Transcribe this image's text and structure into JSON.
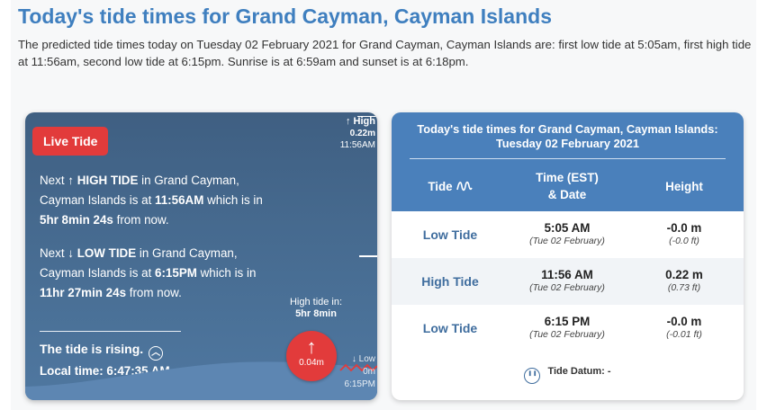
{
  "page": {
    "title": "Today's tide times for Grand Cayman, Cayman Islands",
    "intro": "The predicted tide times today on Tuesday 02 February 2021 for Grand Cayman, Cayman Islands are: first low tide at 5:05am, first high tide at 11:56am, second low tide at 6:15pm. Sunrise is at 6:59am and sunset is at 6:18pm."
  },
  "live": {
    "badge": "Live Tide",
    "next_high": {
      "prefix": "Next ",
      "arrow": "↑",
      "label": "HIGH TIDE",
      "mid": " in Grand Cayman, Cayman Islands is at ",
      "time": "11:56AM",
      "mid2": " which is in ",
      "countdown": "5hr 8min 24s",
      "suffix": " from now."
    },
    "next_low": {
      "prefix": "Next ",
      "arrow": "↓",
      "label": "LOW TIDE",
      "mid": " in Grand Cayman, Cayman Islands is at ",
      "time": "6:15PM",
      "mid2": " which is in ",
      "countdown": "11hr 27min 24s",
      "suffix": " from now."
    },
    "status": "The tide is rising.",
    "local_time": "Local time: 6:47:35 AM",
    "high_marker": {
      "arrow": "↑",
      "label": "High",
      "height": "0.22m",
      "time": "11:56AM"
    },
    "low_marker": {
      "arrow": "↓",
      "label": "Low",
      "height": "0m",
      "time": "6:15PM"
    },
    "high_tide_in_label": "High tide in:",
    "high_tide_in_value": "5hr 8min",
    "current": {
      "arrow": "↑",
      "height": "0.04m"
    }
  },
  "table": {
    "title_line1": "Today's tide times for Grand Cayman, Cayman Islands:",
    "title_line2": "Tuesday 02 February 2021",
    "headers": {
      "tide": "Tide",
      "time_line1": "Time (EST)",
      "time_line2": "& Date",
      "height": "Height"
    },
    "rows": [
      {
        "tide": "Low Tide",
        "time": "5:05 AM",
        "date": "(Tue 02 February)",
        "height_m": "-0.0 m",
        "height_ft": "(-0.0 ft)"
      },
      {
        "tide": "High Tide",
        "time": "11:56 AM",
        "date": "(Tue 02 February)",
        "height_m": "0.22 m",
        "height_ft": "(0.73 ft)"
      },
      {
        "tide": "Low Tide",
        "time": "6:15 PM",
        "date": "(Tue 02 February)",
        "height_m": "-0.0 m",
        "height_ft": "(-0.01 ft)"
      }
    ],
    "datum_label": "Tide Datum:",
    "datum_value": "-"
  },
  "colors": {
    "title_blue": "#3f7fbf",
    "accent_red": "#e23b3b",
    "header_blue": "#4a80bb"
  }
}
